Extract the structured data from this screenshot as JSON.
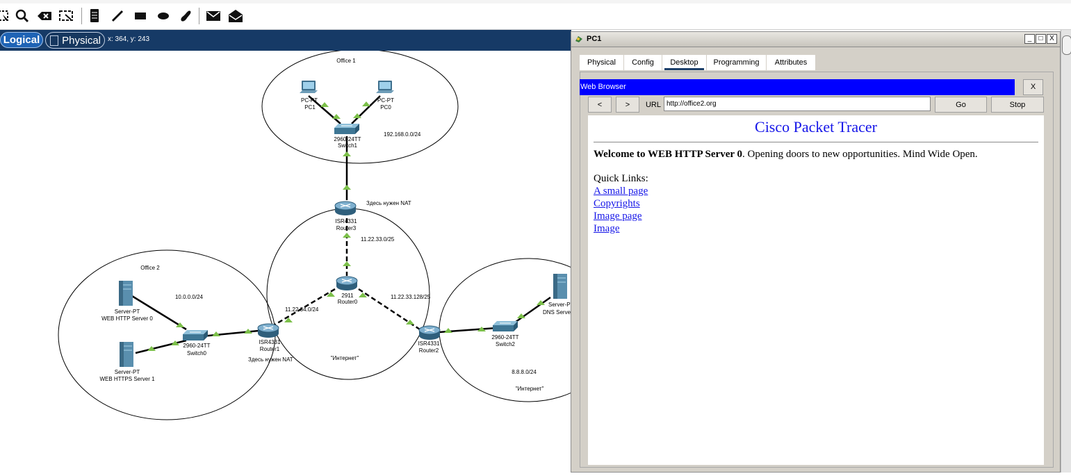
{
  "coords": "x: 364, y: 243",
  "modes": {
    "logical": "Logical",
    "physical": "Physical"
  },
  "toolbar": [
    "select-icon",
    "inspect-icon",
    "delete-icon",
    "resize-icon",
    "note-icon",
    "line-icon",
    "rectangle-icon",
    "ellipse-icon",
    "freeform-icon",
    "simple-pdu-icon",
    "complex-pdu-icon"
  ],
  "topology": {
    "office1": {
      "label": "Office 1"
    },
    "office2": {
      "label": "Office 2"
    },
    "pc1": {
      "type": "PC-PT",
      "name": "PC1"
    },
    "pc0": {
      "type": "PC-PT",
      "name": "PC0"
    },
    "switch1": {
      "type": "2960-24TT",
      "name": "Switch1"
    },
    "net1": "192.168.0.0/24",
    "router3": {
      "type": "ISR4331",
      "name": "Router3"
    },
    "nat1": "Здесь нужен NAT",
    "net2": "11.22.33.0/25",
    "router0": {
      "type": "2911",
      "name": "Router0"
    },
    "net3": "11.22.34.0/24",
    "net4": "11.22.33.128/25",
    "router1": {
      "type": "ISR4331",
      "name": "Router1"
    },
    "nat2": "Здесь нужен NAT",
    "router2": {
      "type": "ISR4331",
      "name": "Router2"
    },
    "internet1": "\"Интернет\"",
    "server0": {
      "type": "Server-PT",
      "name": "WEB HTTP Server 0"
    },
    "server1": {
      "type": "Server-PT",
      "name": "WEB HTTPS Server 1"
    },
    "net5": "10.0.0.0/24",
    "switch0": {
      "type": "2960-24TT",
      "name": "Switch0"
    },
    "switch2": {
      "type": "2960-24TT",
      "name": "Switch2"
    },
    "dns": {
      "type": "Server-PT",
      "name": "DNS Server"
    },
    "net6": "8.8.8.0/24",
    "internet2": "\"Интернет\""
  },
  "window": {
    "title": "PC1",
    "controls": {
      "min": "_",
      "max": "□",
      "close": "X"
    },
    "tabs": [
      "Physical",
      "Config",
      "Desktop",
      "Programming",
      "Attributes"
    ],
    "active_tab": "Desktop"
  },
  "browser": {
    "title": "Web Browser",
    "close": "X",
    "back": "<",
    "forward": ">",
    "url_label": "URL",
    "url": "http://office2.org",
    "go": "Go",
    "stop": "Stop",
    "page": {
      "heading": "Cisco Packet Tracer",
      "welcome_bold": "Welcome to WEB HTTP Server 0",
      "welcome_rest": ". Opening doors to new opportunities. Mind Wide Open.",
      "quick_links": "Quick Links:",
      "links": [
        "A small page",
        "Copyrights",
        "Image page",
        "Image"
      ]
    }
  }
}
